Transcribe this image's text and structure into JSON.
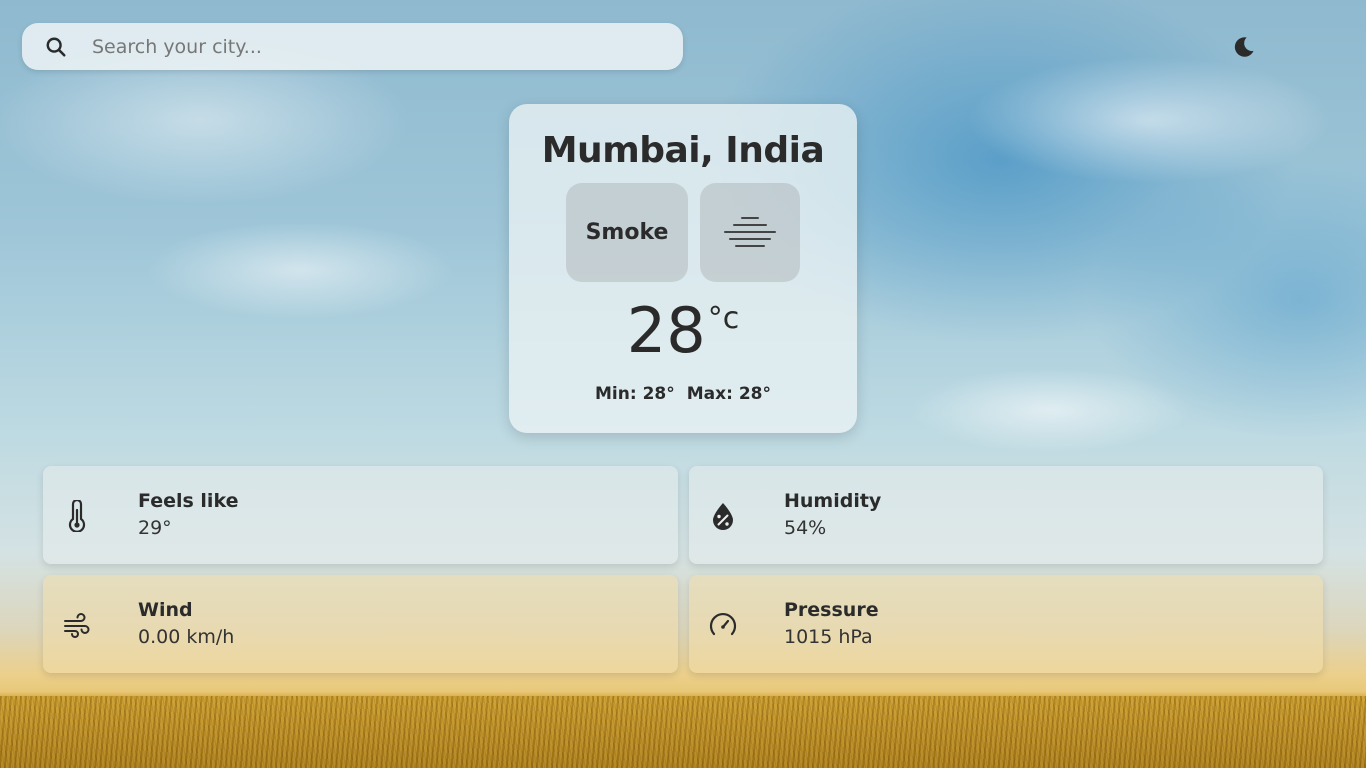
{
  "search": {
    "placeholder": "Search your city..."
  },
  "icons": {
    "search": "search-icon",
    "theme": "moon-icon",
    "condition": "haze-icon",
    "feels_like": "thermometer-icon",
    "humidity": "humidity-drop-icon",
    "wind": "wind-icon",
    "pressure": "gauge-icon"
  },
  "current": {
    "location": "Mumbai, India",
    "condition": "Smoke",
    "temperature": "28",
    "unit": "°c",
    "min": "Min: 28°",
    "max": "Max: 28°"
  },
  "stats": {
    "feels_like": {
      "label": "Feels like",
      "value": "29°"
    },
    "humidity": {
      "label": "Humidity",
      "value": "54%"
    },
    "wind": {
      "label": "Wind",
      "value": "0.00 km/h"
    },
    "pressure": {
      "label": "Pressure",
      "value": "1015 hPa"
    }
  },
  "colors": {
    "text": "#2b2b2b",
    "card": "#ebf2f4"
  }
}
